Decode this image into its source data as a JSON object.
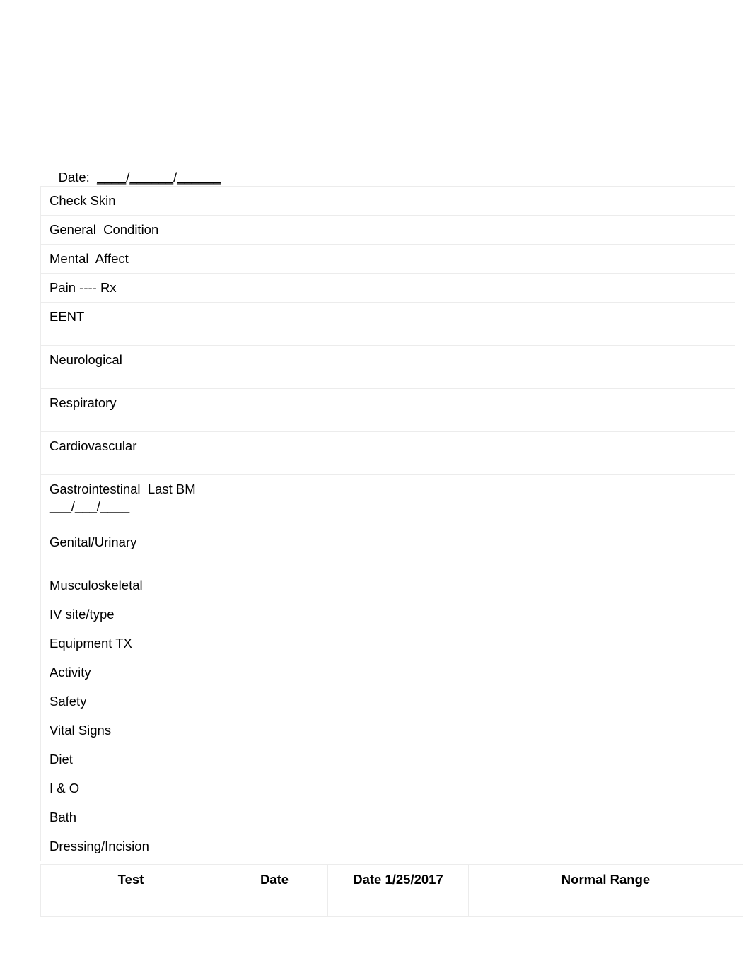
{
  "form": {
    "date_label": "Date:",
    "date_blank_1": "____",
    "date_sep_1": "/",
    "date_blank_2": "______",
    "date_sep_2": "/",
    "date_blank_3": "______",
    "date_full_text": "Date:  ____/______/______"
  },
  "assessment": {
    "rows": [
      {
        "label": "Check Skin",
        "value": "",
        "size": "std"
      },
      {
        "label": "General  Condition",
        "value": "",
        "size": "std"
      },
      {
        "label": "Mental  Affect",
        "value": "",
        "size": "std"
      },
      {
        "label": "Pain ---- Rx",
        "value": "",
        "size": "std"
      },
      {
        "label": "EENT",
        "value": "",
        "size": "tall"
      },
      {
        "label": "Neurological",
        "value": "",
        "size": "tall"
      },
      {
        "label": "Respiratory",
        "value": "",
        "size": "tall"
      },
      {
        "label": "Cardiovascular",
        "value": "",
        "size": "tall"
      },
      {
        "label": "Gastrointestinal  Last BM ___/___/____",
        "value": "",
        "size": "xtall"
      },
      {
        "label": "Genital/Urinary",
        "value": "",
        "size": "tall"
      },
      {
        "label": "Musculoskeletal",
        "value": "",
        "size": "std"
      },
      {
        "label": "IV site/type",
        "value": "",
        "size": "std"
      },
      {
        "label": "Equipment TX",
        "value": "",
        "size": "std"
      },
      {
        "label": "Activity",
        "value": "",
        "size": "std"
      },
      {
        "label": "Safety",
        "value": "",
        "size": "std"
      },
      {
        "label": "Vital Signs",
        "value": "",
        "size": "std"
      },
      {
        "label": "Diet",
        "value": "",
        "size": "std"
      },
      {
        "label": "I & O",
        "value": "",
        "size": "std"
      },
      {
        "label": "Bath",
        "value": "",
        "size": "std"
      },
      {
        "label": "Dressing/Incision",
        "value": "",
        "size": "std"
      }
    ]
  },
  "labs": {
    "headers": [
      {
        "label": "Test"
      },
      {
        "label": "Date"
      },
      {
        "label": "Date 1/25/2017"
      },
      {
        "label": "Normal Range"
      }
    ]
  },
  "colors": {
    "page_background": "#ffffff",
    "text": "#000000",
    "border": "#ececec"
  }
}
